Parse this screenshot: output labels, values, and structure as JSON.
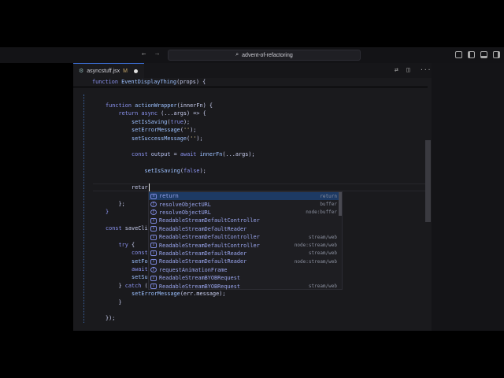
{
  "window": {
    "search_text": "advent-of-refactoring",
    "back_icon": "arrow-left-icon",
    "forward_icon": "arrow-right-icon"
  },
  "tab": {
    "filename": "asyncstuff.jsx",
    "status": "M"
  },
  "sticky": [
    [
      "function ",
      "kw"
    ],
    [
      "EventDisplayThing",
      "fn"
    ],
    [
      "(props) {",
      ""
    ]
  ],
  "lines": [
    [
      0,
      [
        [
          "function ",
          "kw"
        ],
        [
          "actionWrapper",
          "fn"
        ],
        [
          "(innerFn) {",
          ""
        ]
      ]
    ],
    [
      1,
      [
        [
          "return ",
          "kw"
        ],
        [
          "async ",
          "kw"
        ],
        [
          "(...args) => {",
          ""
        ]
      ]
    ],
    [
      2,
      [
        [
          "setIsSaving",
          "fn"
        ],
        [
          "(",
          ""
        ],
        [
          "true",
          "lit"
        ],
        [
          ");",
          ""
        ]
      ]
    ],
    [
      3,
      [
        [
          "setErrorMessage",
          "fn"
        ],
        [
          "(",
          ""
        ],
        [
          "''",
          "str"
        ],
        [
          ");",
          ""
        ]
      ]
    ],
    [
      4,
      [
        [
          "setSuccessMessage",
          "fn"
        ],
        [
          "(",
          ""
        ],
        [
          "''",
          "str"
        ],
        [
          ");",
          ""
        ]
      ]
    ],
    [
      6,
      [
        [
          "const ",
          "kw"
        ],
        [
          "output ",
          "pr"
        ],
        [
          "= ",
          ""
        ],
        [
          "await ",
          "kw"
        ],
        [
          "innerFn",
          "fn"
        ],
        [
          "(...args);",
          ""
        ]
      ]
    ],
    [
      8,
      [
        [
          "setIsSaving",
          "fn"
        ],
        [
          "(",
          ""
        ],
        [
          "false",
          "lit"
        ],
        [
          ");",
          ""
        ]
      ]
    ],
    [
      10,
      [
        [
          "retur",
          ""
        ]
      ]
    ],
    [
      12,
      [
        [
          "};",
          ""
        ]
      ]
    ],
    [
      13,
      [
        [
          "}",
          "kw"
        ]
      ]
    ],
    [
      15,
      [
        [
          "const ",
          "kw"
        ],
        [
          "saveCli",
          ""
        ]
      ]
    ],
    [
      17,
      [
        [
          "try ",
          "kw"
        ],
        [
          "{",
          ""
        ]
      ]
    ],
    [
      18,
      [
        [
          "const",
          "kw"
        ]
      ]
    ],
    [
      19,
      [
        [
          "setFo",
          "fn"
        ]
      ]
    ],
    [
      20,
      [
        [
          "await",
          "kw"
        ]
      ]
    ],
    [
      21,
      [
        [
          "setSu",
          "fn"
        ]
      ]
    ],
    [
      22,
      [
        [
          "} ",
          ""
        ],
        [
          "catch ",
          "kw"
        ],
        [
          "(",
          ""
        ]
      ]
    ],
    [
      23,
      [
        [
          "setErrorMessage",
          "fn"
        ],
        [
          "(err.message);",
          ""
        ]
      ]
    ],
    [
      24,
      [
        [
          "}",
          ""
        ]
      ]
    ],
    [
      26,
      [
        [
          "});",
          ""
        ]
      ]
    ]
  ],
  "indent": {
    "0": 0,
    "1": 1,
    "2": 2,
    "3": 2,
    "4": 2,
    "6": 2,
    "8": 3,
    "10": 2,
    "12": 1,
    "13": 0,
    "15": 0,
    "17": 1,
    "18": 2,
    "19": 2,
    "20": 2,
    "21": 2,
    "22": 1,
    "23": 2,
    "24": 1,
    "26": 0
  },
  "suggestions": [
    {
      "label": "return",
      "detail": "return",
      "icon": "keyword-icon"
    },
    {
      "label": "resolveObjectURL",
      "detail": "buffer",
      "icon": "function-icon"
    },
    {
      "label": "resolveObjectURL",
      "detail": "node:buffer",
      "icon": "function-icon"
    },
    {
      "label": "ReadableStreamDefaultController",
      "detail": "",
      "icon": "variable-icon"
    },
    {
      "label": "ReadableStreamDefaultReader",
      "detail": "",
      "icon": "variable-icon"
    },
    {
      "label": "ReadableStreamDefaultController",
      "detail": "stream/web",
      "icon": "variable-icon"
    },
    {
      "label": "ReadableStreamDefaultController",
      "detail": "node:stream/web",
      "icon": "variable-icon"
    },
    {
      "label": "ReadableStreamDefaultReader",
      "detail": "stream/web",
      "icon": "variable-icon"
    },
    {
      "label": "ReadableStreamDefaultReader",
      "detail": "node:stream/web",
      "icon": "variable-icon"
    },
    {
      "label": "requestAnimationFrame",
      "detail": "",
      "icon": "function-icon"
    },
    {
      "label": "ReadableStreamBYOBRequest",
      "detail": "",
      "icon": "variable-icon"
    },
    {
      "label": "ReadableStreamBYOBRequest",
      "detail": "stream/web",
      "icon": "variable-icon"
    }
  ]
}
